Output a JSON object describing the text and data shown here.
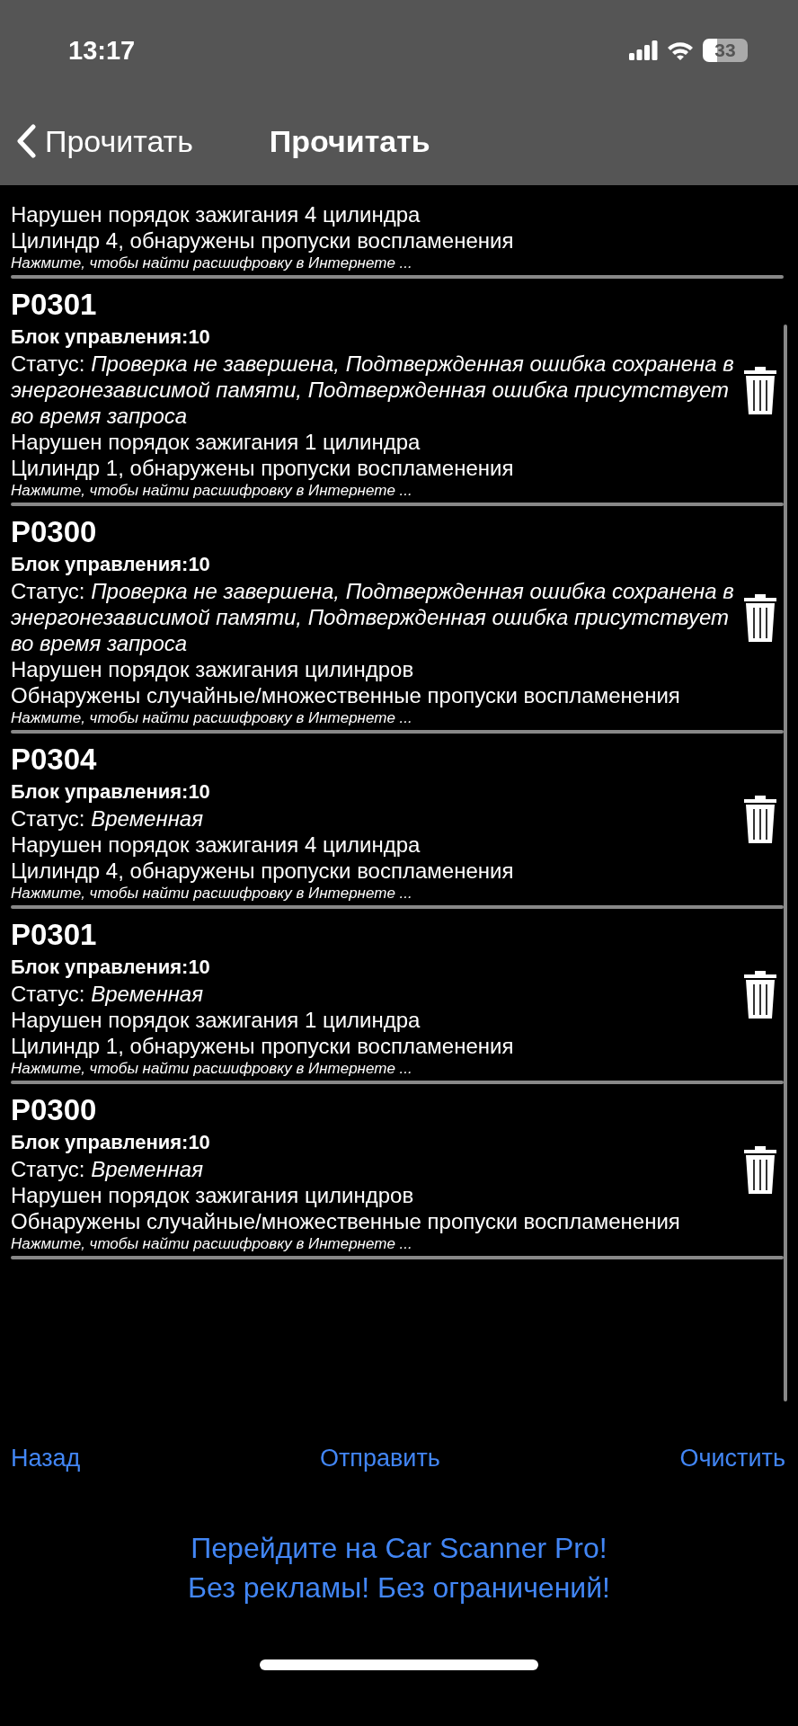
{
  "status_bar": {
    "time": "13:17",
    "battery": "33"
  },
  "nav": {
    "back_label": "Прочитать",
    "title": "Прочитать"
  },
  "partial_entry": {
    "lines": [
      "Нарушен порядок зажигания 4 цилиндра",
      "Цилиндр 4, обнаружены пропуски воспламенения"
    ],
    "hint": "Нажмите, чтобы найти расшифровку в Интернете ..."
  },
  "entries": [
    {
      "code": "P0301",
      "unit": "Блок управления:10",
      "status": "Статус: *Проверка не завершена, Подтвержденная ошибка сохранена в энергонезависимой памяти, Подтвержденная ошибка присутствует во время запроса*",
      "lines": [
        "Нарушен порядок зажигания 1 цилиндра",
        "Цилиндр 1, обнаружены пропуски воспламенения"
      ],
      "hint": "Нажмите, чтобы найти расшифровку в Интернете ..."
    },
    {
      "code": "P0300",
      "unit": "Блок управления:10",
      "status": "Статус: *Проверка не завершена, Подтвержденная ошибка сохранена в энергонезависимой памяти, Подтвержденная ошибка присутствует во время запроса*",
      "lines": [
        "Нарушен порядок зажигания цилиндров",
        "Обнаружены случайные/множественные пропуски воспламенения"
      ],
      "hint": "Нажмите, чтобы найти расшифровку в Интернете ..."
    },
    {
      "code": "P0304",
      "unit": "Блок управления:10",
      "status": "Статус: *Временная*",
      "lines": [
        "Нарушен порядок зажигания 4 цилиндра",
        "Цилиндр 4, обнаружены пропуски воспламенения"
      ],
      "hint": "Нажмите, чтобы найти расшифровку в Интернете ..."
    },
    {
      "code": "P0301",
      "unit": "Блок управления:10",
      "status": "Статус: *Временная*",
      "lines": [
        "Нарушен порядок зажигания 1 цилиндра",
        "Цилиндр 1, обнаружены пропуски воспламенения"
      ],
      "hint": "Нажмите, чтобы найти расшифровку в Интернете ..."
    },
    {
      "code": "P0300",
      "unit": "Блок управления:10",
      "status": "Статус: *Временная*",
      "lines": [
        "Нарушен порядок зажигания цилиндров",
        "Обнаружены случайные/множественные пропуски воспламенения"
      ],
      "hint": "Нажмите, чтобы найти расшифровку в Интернете ..."
    }
  ],
  "actions": [
    "Назад",
    "Отправить",
    "Очистить"
  ],
  "promo": [
    "Перейдите на Car Scanner Pro!",
    "Без рекламы! Без ограничений!"
  ]
}
